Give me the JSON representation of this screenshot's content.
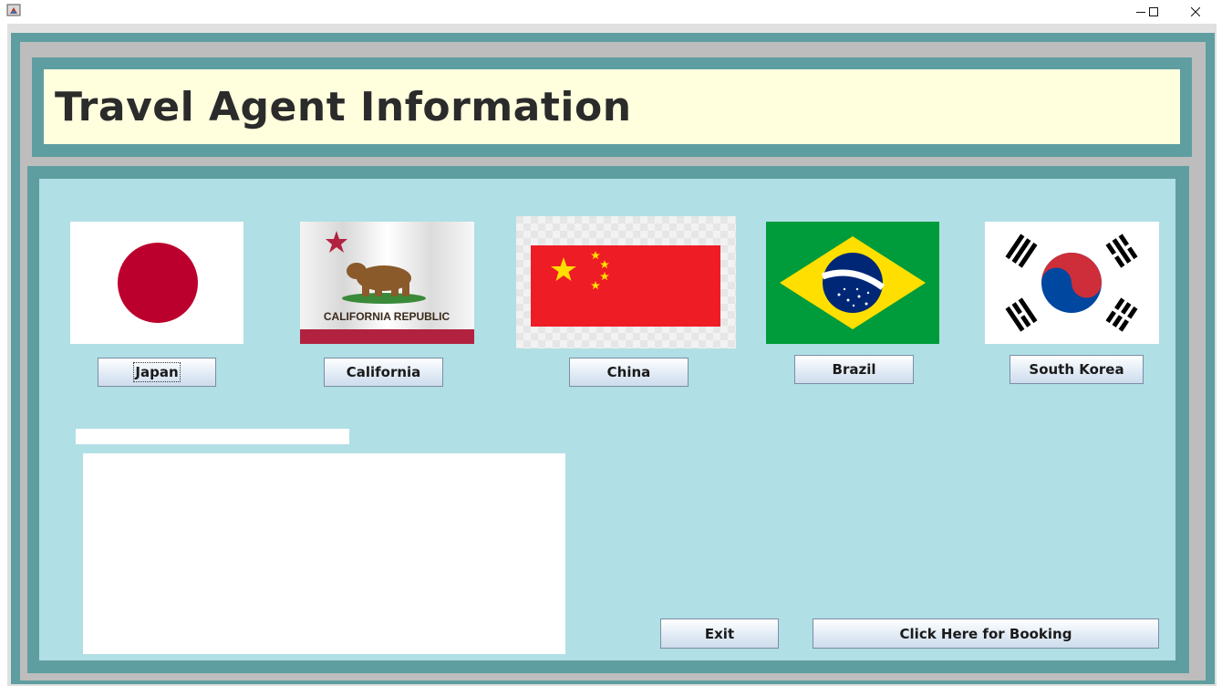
{
  "window": {
    "app_icon": "java-app-icon",
    "controls": [
      "minimize-icon",
      "maximize-icon",
      "close-icon"
    ]
  },
  "header": {
    "title": "Travel Agent Information"
  },
  "destinations": [
    {
      "flag": "japan-flag",
      "label": "Japan"
    },
    {
      "flag": "california-flag",
      "label": "California",
      "flag_text": "CALIFORNIA REPUBLIC"
    },
    {
      "flag": "china-flag",
      "label": "China"
    },
    {
      "flag": "brazil-flag",
      "label": "Brazil"
    },
    {
      "flag": "south-korea-flag",
      "label": "South Korea"
    }
  ],
  "info": {
    "name_field_value": "",
    "details_area_value": ""
  },
  "actions": {
    "exit_label": "Exit",
    "booking_label": "Click Here for Booking"
  },
  "colors": {
    "frame_teal": "#5f9ea0",
    "panel_background": "#b0dfe5",
    "header_background": "#ffffde"
  }
}
